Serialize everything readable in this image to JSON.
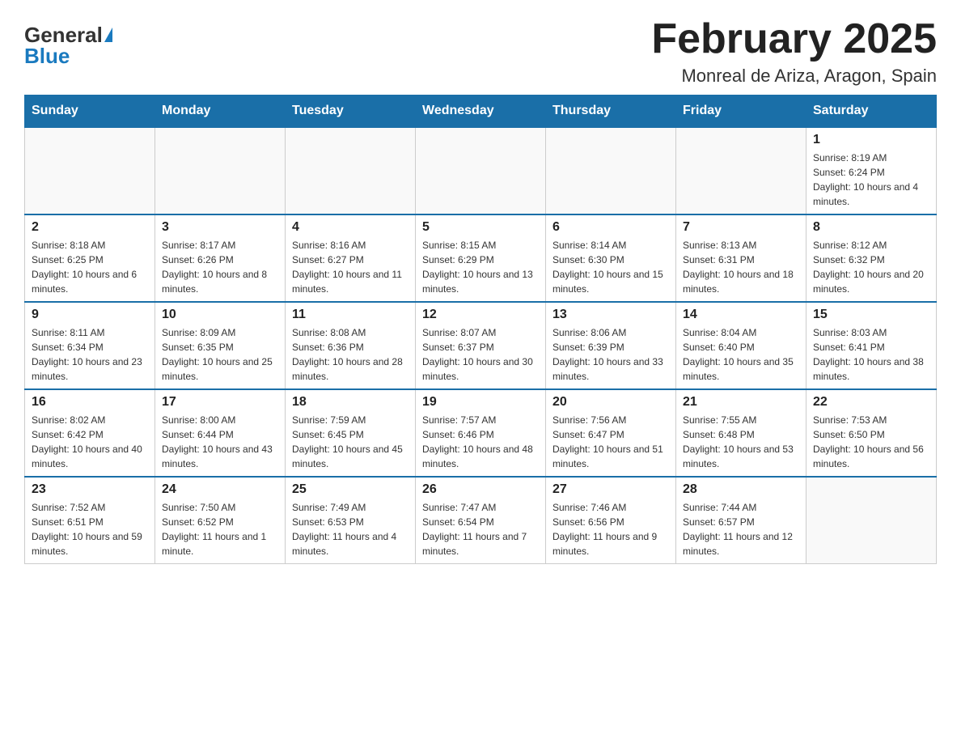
{
  "header": {
    "logo_general": "General",
    "logo_blue": "Blue",
    "month_title": "February 2025",
    "location": "Monreal de Ariza, Aragon, Spain"
  },
  "weekdays": [
    "Sunday",
    "Monday",
    "Tuesday",
    "Wednesday",
    "Thursday",
    "Friday",
    "Saturday"
  ],
  "weeks": [
    [
      {
        "day": "",
        "sunrise": "",
        "sunset": "",
        "daylight": ""
      },
      {
        "day": "",
        "sunrise": "",
        "sunset": "",
        "daylight": ""
      },
      {
        "day": "",
        "sunrise": "",
        "sunset": "",
        "daylight": ""
      },
      {
        "day": "",
        "sunrise": "",
        "sunset": "",
        "daylight": ""
      },
      {
        "day": "",
        "sunrise": "",
        "sunset": "",
        "daylight": ""
      },
      {
        "day": "",
        "sunrise": "",
        "sunset": "",
        "daylight": ""
      },
      {
        "day": "1",
        "sunrise": "Sunrise: 8:19 AM",
        "sunset": "Sunset: 6:24 PM",
        "daylight": "Daylight: 10 hours and 4 minutes."
      }
    ],
    [
      {
        "day": "2",
        "sunrise": "Sunrise: 8:18 AM",
        "sunset": "Sunset: 6:25 PM",
        "daylight": "Daylight: 10 hours and 6 minutes."
      },
      {
        "day": "3",
        "sunrise": "Sunrise: 8:17 AM",
        "sunset": "Sunset: 6:26 PM",
        "daylight": "Daylight: 10 hours and 8 minutes."
      },
      {
        "day": "4",
        "sunrise": "Sunrise: 8:16 AM",
        "sunset": "Sunset: 6:27 PM",
        "daylight": "Daylight: 10 hours and 11 minutes."
      },
      {
        "day": "5",
        "sunrise": "Sunrise: 8:15 AM",
        "sunset": "Sunset: 6:29 PM",
        "daylight": "Daylight: 10 hours and 13 minutes."
      },
      {
        "day": "6",
        "sunrise": "Sunrise: 8:14 AM",
        "sunset": "Sunset: 6:30 PM",
        "daylight": "Daylight: 10 hours and 15 minutes."
      },
      {
        "day": "7",
        "sunrise": "Sunrise: 8:13 AM",
        "sunset": "Sunset: 6:31 PM",
        "daylight": "Daylight: 10 hours and 18 minutes."
      },
      {
        "day": "8",
        "sunrise": "Sunrise: 8:12 AM",
        "sunset": "Sunset: 6:32 PM",
        "daylight": "Daylight: 10 hours and 20 minutes."
      }
    ],
    [
      {
        "day": "9",
        "sunrise": "Sunrise: 8:11 AM",
        "sunset": "Sunset: 6:34 PM",
        "daylight": "Daylight: 10 hours and 23 minutes."
      },
      {
        "day": "10",
        "sunrise": "Sunrise: 8:09 AM",
        "sunset": "Sunset: 6:35 PM",
        "daylight": "Daylight: 10 hours and 25 minutes."
      },
      {
        "day": "11",
        "sunrise": "Sunrise: 8:08 AM",
        "sunset": "Sunset: 6:36 PM",
        "daylight": "Daylight: 10 hours and 28 minutes."
      },
      {
        "day": "12",
        "sunrise": "Sunrise: 8:07 AM",
        "sunset": "Sunset: 6:37 PM",
        "daylight": "Daylight: 10 hours and 30 minutes."
      },
      {
        "day": "13",
        "sunrise": "Sunrise: 8:06 AM",
        "sunset": "Sunset: 6:39 PM",
        "daylight": "Daylight: 10 hours and 33 minutes."
      },
      {
        "day": "14",
        "sunrise": "Sunrise: 8:04 AM",
        "sunset": "Sunset: 6:40 PM",
        "daylight": "Daylight: 10 hours and 35 minutes."
      },
      {
        "day": "15",
        "sunrise": "Sunrise: 8:03 AM",
        "sunset": "Sunset: 6:41 PM",
        "daylight": "Daylight: 10 hours and 38 minutes."
      }
    ],
    [
      {
        "day": "16",
        "sunrise": "Sunrise: 8:02 AM",
        "sunset": "Sunset: 6:42 PM",
        "daylight": "Daylight: 10 hours and 40 minutes."
      },
      {
        "day": "17",
        "sunrise": "Sunrise: 8:00 AM",
        "sunset": "Sunset: 6:44 PM",
        "daylight": "Daylight: 10 hours and 43 minutes."
      },
      {
        "day": "18",
        "sunrise": "Sunrise: 7:59 AM",
        "sunset": "Sunset: 6:45 PM",
        "daylight": "Daylight: 10 hours and 45 minutes."
      },
      {
        "day": "19",
        "sunrise": "Sunrise: 7:57 AM",
        "sunset": "Sunset: 6:46 PM",
        "daylight": "Daylight: 10 hours and 48 minutes."
      },
      {
        "day": "20",
        "sunrise": "Sunrise: 7:56 AM",
        "sunset": "Sunset: 6:47 PM",
        "daylight": "Daylight: 10 hours and 51 minutes."
      },
      {
        "day": "21",
        "sunrise": "Sunrise: 7:55 AM",
        "sunset": "Sunset: 6:48 PM",
        "daylight": "Daylight: 10 hours and 53 minutes."
      },
      {
        "day": "22",
        "sunrise": "Sunrise: 7:53 AM",
        "sunset": "Sunset: 6:50 PM",
        "daylight": "Daylight: 10 hours and 56 minutes."
      }
    ],
    [
      {
        "day": "23",
        "sunrise": "Sunrise: 7:52 AM",
        "sunset": "Sunset: 6:51 PM",
        "daylight": "Daylight: 10 hours and 59 minutes."
      },
      {
        "day": "24",
        "sunrise": "Sunrise: 7:50 AM",
        "sunset": "Sunset: 6:52 PM",
        "daylight": "Daylight: 11 hours and 1 minute."
      },
      {
        "day": "25",
        "sunrise": "Sunrise: 7:49 AM",
        "sunset": "Sunset: 6:53 PM",
        "daylight": "Daylight: 11 hours and 4 minutes."
      },
      {
        "day": "26",
        "sunrise": "Sunrise: 7:47 AM",
        "sunset": "Sunset: 6:54 PM",
        "daylight": "Daylight: 11 hours and 7 minutes."
      },
      {
        "day": "27",
        "sunrise": "Sunrise: 7:46 AM",
        "sunset": "Sunset: 6:56 PM",
        "daylight": "Daylight: 11 hours and 9 minutes."
      },
      {
        "day": "28",
        "sunrise": "Sunrise: 7:44 AM",
        "sunset": "Sunset: 6:57 PM",
        "daylight": "Daylight: 11 hours and 12 minutes."
      },
      {
        "day": "",
        "sunrise": "",
        "sunset": "",
        "daylight": ""
      }
    ]
  ]
}
